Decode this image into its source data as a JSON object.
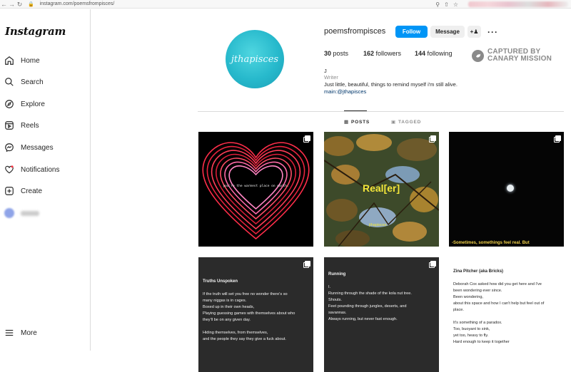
{
  "browser": {
    "url": "instagram.com/poemsfrompisces/"
  },
  "sidebar": {
    "logo": "Instagram",
    "items": [
      {
        "label": "Home"
      },
      {
        "label": "Search"
      },
      {
        "label": "Explore"
      },
      {
        "label": "Reels"
      },
      {
        "label": "Messages"
      },
      {
        "label": "Notifications"
      },
      {
        "label": "Create"
      }
    ],
    "more": "More"
  },
  "profile": {
    "username": "poemsfrompisces",
    "avatar_text": "jthapisces",
    "follow": "Follow",
    "message": "Message",
    "posts": "30",
    "posts_label": "posts",
    "followers": "162",
    "followers_label": "followers",
    "following": "144",
    "following_label": "following",
    "bio_name": "J",
    "bio_category": "Writer",
    "bio_text": "Just little, beautiful, things to remind myself i'm still alive.",
    "bio_link": "main:@jthapisces"
  },
  "watermark": {
    "line1": "CAPTURED BY",
    "line2": "CANARY MISSION"
  },
  "tabs": {
    "posts": "POSTS",
    "tagged": "TAGGED"
  },
  "posts": {
    "p1_caption": "you're the warmest place on earth.",
    "p2_title": "Real[er]",
    "p2_tag": "jthapisces",
    "p3_caption": "-Sometimes, somethings feel real. But",
    "p4": {
      "title": "Truths Unspoken",
      "lines": [
        "If the truth will set you free no wonder there's  so",
        "many niggas is in cages.",
        "Boxed up in their own heads,",
        "Playing guessing games with themselves about who",
        "they'll be on any given day.",
        "",
        "Hiding themselves, from themselves,",
        "and the people they say they give a fuck about."
      ]
    },
    "p5": {
      "title": "Running",
      "lines": [
        "I.",
        "Running through the shade of the kola nut tree.",
        "Shouts.",
        "Feet pounding through jungles, deserts, and",
        "savannas.",
        "Always running, but never fast enough."
      ]
    },
    "p6": {
      "title": "Zina Pitcher (aka Bricks)",
      "lines": [
        "Deborah Cox asked how did you get here and I've",
        "been wondering ever since.",
        "Been wondering,",
        "about this space and how I can't help but feel out of",
        "place.",
        "",
        "It's something of a paradox.",
        "Too, buoyant to sink,",
        "yet too, heavy to fly.",
        "Hard enough to keep it together"
      ]
    }
  }
}
